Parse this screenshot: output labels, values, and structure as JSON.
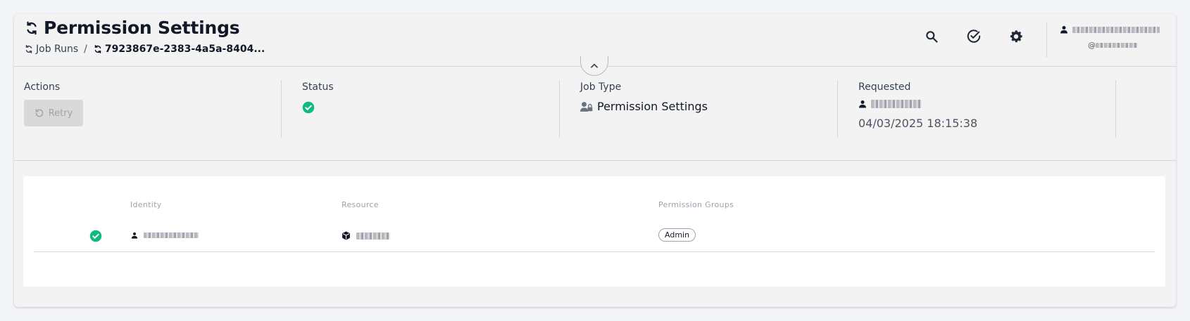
{
  "header": {
    "title": "Permission Settings",
    "breadcrumb": {
      "parent": "Job Runs",
      "separator": "/",
      "current": "7923867e-2383-4a5a-8404..."
    },
    "icons": [
      "search-icon",
      "check-circle-icon",
      "gear-icon"
    ],
    "user": {
      "handle_prefix": "@"
    }
  },
  "details": {
    "actions_label": "Actions",
    "retry_label": "Retry",
    "status_label": "Status",
    "job_type_label": "Job Type",
    "job_type_value": "Permission Settings",
    "requested_label": "Requested",
    "requested_time": "04/03/2025 18:15:38"
  },
  "table": {
    "columns": [
      "Identity",
      "Resource",
      "Permission Groups"
    ],
    "rows": [
      {
        "status": "success",
        "permission_group": "Admin"
      }
    ]
  },
  "colors": {
    "success": "#10b981",
    "icon_dark": "#1f2937",
    "card_bg": "#f3f3f3"
  }
}
